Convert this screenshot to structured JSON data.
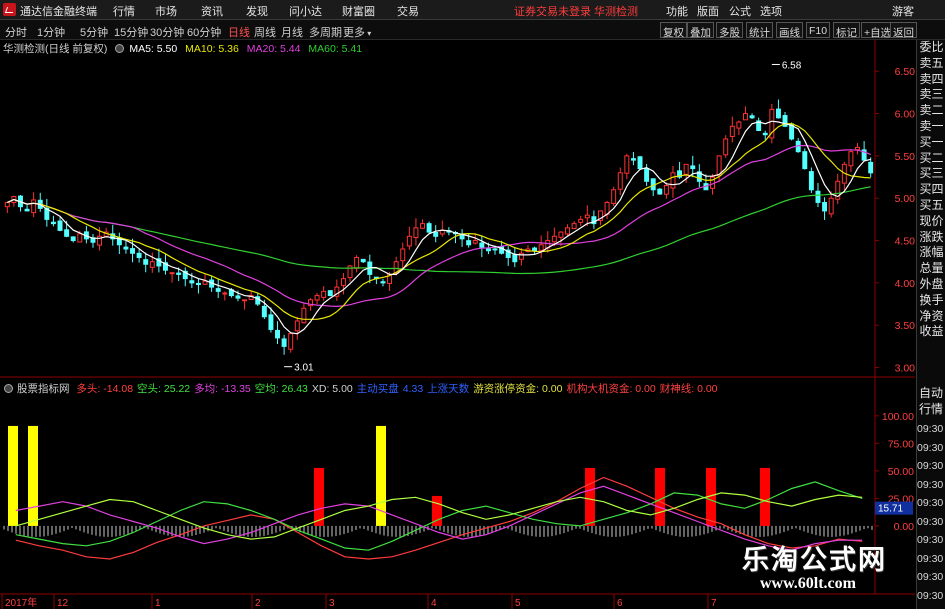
{
  "titlebar": {
    "app_title": "通达信金融终端",
    "menu": [
      "行情",
      "市场",
      "资讯",
      "发现",
      "问小达",
      "财富圈",
      "交易"
    ],
    "notice": "证券交易未登录  华测检测",
    "right_menu": [
      "功能",
      "版面",
      "公式",
      "选项"
    ],
    "guest": "游客"
  },
  "toolbar": {
    "periods": [
      "分时",
      "1分钟",
      "5分钟",
      "15分钟",
      "30分钟",
      "60分钟",
      "日线",
      "周线",
      "月线",
      "多周期",
      "更多"
    ],
    "active_period": "日线",
    "buttons": [
      "复权",
      "叠加",
      "多股",
      "统计",
      "画线",
      "F10",
      "标记",
      "+自选",
      "返回"
    ]
  },
  "main_info": {
    "stock": "华测检测(日线 前复权)",
    "ma5": "MA5: 5.50",
    "ma10": "MA10: 5.36",
    "ma20": "MA20: 5.44",
    "ma60": "MA60: 5.41"
  },
  "sub_info": {
    "indicator": "股票指标网",
    "items": [
      {
        "text": "多头: -14.08",
        "color": "#ff4040"
      },
      {
        "text": "空头: 25.22",
        "color": "#40e040"
      },
      {
        "text": "多均: -13.35",
        "color": "#e040e0"
      },
      {
        "text": "空均: 26.43",
        "color": "#40e040"
      },
      {
        "text": "XD: 5.00",
        "color": "#d0d0d0"
      },
      {
        "text": "主动买盘",
        "color": "#3060ff"
      },
      {
        "text": "4.33",
        "color": "#3060ff"
      },
      {
        "text": "上涨天数",
        "color": "#3060ff"
      },
      {
        "text": "游资涨停资金: 0.00",
        "color": "#e0e040"
      },
      {
        "text": "机构大机资金: 0.00",
        "color": "#ff4040"
      },
      {
        "text": "财神线: 0.00",
        "color": "#ff4040"
      }
    ]
  },
  "side_panel": [
    "委比",
    "卖五",
    "卖四",
    "卖三",
    "卖二",
    "卖一",
    "买一",
    "买二",
    "买三",
    "买四",
    "买五",
    "现价",
    "涨跌",
    "涨幅",
    "总量",
    "外盘",
    "换手",
    "净资",
    "收益"
  ],
  "auto_quote": "自动行情",
  "time_labels": [
    "09:30",
    "09:30",
    "09:30",
    "09:30",
    "09:30",
    "09:30",
    "09:30",
    "09:30",
    "09:30",
    "09:30",
    "09:30"
  ],
  "watermark": {
    "line1": "乐淘公式网",
    "line2": "www.60lt.com"
  },
  "colors": {
    "up": "#ff3232",
    "down": "#54ffff",
    "ma5": "#ffffff",
    "ma10": "#e8e800",
    "ma20": "#e040e0",
    "ma60": "#30d030",
    "signal_red": "#ff0000",
    "signal_yellow": "#ffff00"
  },
  "chart_data": [
    {
      "type": "candlestick",
      "title": "华测检测(日线 前复权)",
      "y_ticks": [
        3.0,
        3.5,
        4.0,
        4.5,
        5.0,
        5.5,
        6.0,
        6.5
      ],
      "ylim": [
        2.9,
        6.68
      ],
      "annotations": [
        {
          "label": "6.58",
          "kind": "high"
        },
        {
          "label": "3.01",
          "kind": "low"
        }
      ],
      "closes": [
        4.95,
        5.02,
        4.9,
        4.85,
        4.98,
        4.88,
        4.75,
        4.7,
        4.62,
        4.55,
        4.5,
        4.58,
        4.52,
        4.48,
        4.55,
        4.6,
        4.52,
        4.45,
        4.4,
        4.35,
        4.3,
        4.22,
        4.25,
        4.2,
        4.15,
        4.12,
        4.1,
        4.05,
        4.0,
        3.98,
        4.02,
        3.95,
        3.9,
        3.88,
        3.85,
        3.82,
        3.8,
        3.85,
        3.75,
        3.6,
        3.45,
        3.35,
        3.25,
        3.4,
        3.55,
        3.7,
        3.8,
        3.85,
        3.9,
        3.85,
        3.95,
        4.05,
        4.2,
        4.3,
        4.25,
        4.1,
        4.05,
        4.0,
        4.1,
        4.25,
        4.4,
        4.55,
        4.65,
        4.7,
        4.6,
        4.55,
        4.62,
        4.6,
        4.58,
        4.52,
        4.45,
        4.5,
        4.42,
        4.38,
        4.4,
        4.35,
        4.3,
        4.25,
        4.35,
        4.4,
        4.38,
        4.45,
        4.5,
        4.55,
        4.6,
        4.65,
        4.7,
        4.75,
        4.8,
        4.7,
        4.85,
        4.95,
        5.1,
        5.3,
        5.5,
        5.45,
        5.35,
        5.2,
        5.1,
        5.05,
        5.15,
        5.3,
        5.25,
        5.4,
        5.35,
        5.2,
        5.1,
        5.25,
        5.5,
        5.7,
        5.85,
        5.9,
        6.0,
        5.95,
        5.8,
        5.75,
        6.05,
        5.95,
        5.85,
        5.7,
        5.55,
        5.35,
        5.1,
        4.95,
        4.85,
        5.0,
        5.2,
        5.4,
        5.55,
        5.6,
        5.45,
        5.3
      ]
    },
    {
      "type": "line",
      "title": "股票指标网",
      "y_ticks": [
        0,
        25,
        50,
        75,
        100
      ],
      "ylim": [
        -60,
        118
      ],
      "series": [
        {
          "name": "多头",
          "values": [
            -13,
            -18,
            -22,
            -28,
            -30,
            -24,
            -15,
            -8,
            0,
            5,
            10,
            6,
            -6,
            -18,
            -28,
            -30,
            -28,
            -22,
            -15,
            -8,
            -2,
            4,
            12,
            22,
            34,
            44,
            36,
            26,
            16,
            8,
            2,
            -8,
            -16,
            -20,
            -18,
            -12,
            -14
          ]
        },
        {
          "name": "空头",
          "values": [
            -8,
            -12,
            -16,
            -18,
            -14,
            -6,
            4,
            14,
            22,
            20,
            14,
            6,
            -4,
            -12,
            -20,
            -22,
            -14,
            -4,
            6,
            14,
            18,
            12,
            6,
            2,
            0,
            6,
            12,
            20,
            30,
            28,
            20,
            16,
            24,
            34,
            40,
            32,
            25
          ]
        },
        {
          "name": "多均",
          "values": [
            14,
            18,
            22,
            18,
            10,
            4,
            -2,
            -10,
            -16,
            -12,
            -6,
            2,
            10,
            16,
            20,
            18,
            10,
            2,
            -6,
            -12,
            -8,
            0,
            10,
            20,
            30,
            36,
            28,
            20,
            12,
            4,
            -4,
            -12,
            -18,
            -22,
            -16,
            -13,
            -13
          ]
        },
        {
          "name": "空均",
          "values": [
            0,
            6,
            12,
            18,
            24,
            22,
            14,
            6,
            -2,
            -8,
            -12,
            -10,
            -2,
            6,
            14,
            18,
            24,
            26,
            20,
            12,
            6,
            10,
            16,
            22,
            26,
            22,
            14,
            10,
            16,
            24,
            30,
            28,
            22,
            18,
            24,
            28,
            26
          ]
        }
      ]
    }
  ],
  "x_axis": {
    "labels": [
      "2017年",
      "12",
      "1",
      "2",
      "3",
      "4",
      "5",
      "6",
      "7"
    ]
  }
}
